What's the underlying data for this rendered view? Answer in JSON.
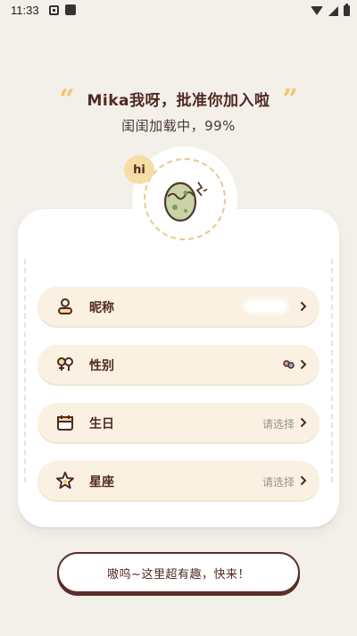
{
  "status_bar": {
    "time": "11:33",
    "icons": [
      "notification-icon",
      "app-icon",
      "wifi-icon",
      "signal-icon",
      "battery-icon"
    ]
  },
  "header": {
    "quote_open": "“",
    "title": "Mika我呀，批准你加入啦",
    "quote_close": "”",
    "subtitle": "闺闺加载中，99%"
  },
  "avatar": {
    "badge": "hi",
    "icon": "egg-icon"
  },
  "form": {
    "rows": [
      {
        "label": "昵称",
        "value": "",
        "icon": "person-icon"
      },
      {
        "label": "性别",
        "value": "",
        "icon": "gender-icon",
        "value_icon": "female-icon"
      },
      {
        "label": "生日",
        "value": "请选择",
        "icon": "calendar-icon"
      },
      {
        "label": "星座",
        "value": "请选择",
        "icon": "star-icon"
      }
    ]
  },
  "cta": {
    "label": "嗷呜~这里超有趣，快来！"
  },
  "colors": {
    "background": "#f3efe9",
    "accent": "#f1c56b",
    "text_dark": "#4e2a24",
    "row_bg": "#fbf1e2",
    "button_border": "#5a2e2b"
  }
}
